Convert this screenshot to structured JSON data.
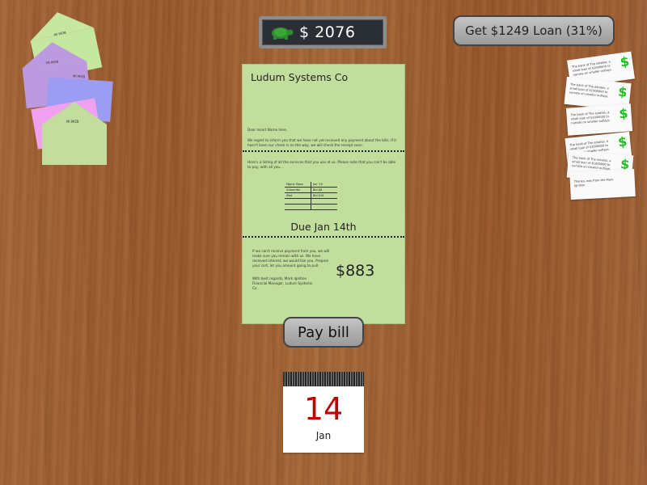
{
  "money": {
    "amount": "$ 2076",
    "icon": "turtle-icon"
  },
  "loan": {
    "label": "Get $1249 Loan (31%)"
  },
  "bill": {
    "company": "Ludum Systems Co",
    "greeting": "Dear Insert Name here,",
    "p1": "We regret to inform you that we have not yet received any payment about the bills. If it hasn't been our check is on the way, we will check the receipt soon.",
    "p2": "Here's a listing of all the services that you use at us. Please note that you can't be able to pay, with all you...",
    "table": [
      [
        "Mgmt. Base",
        "Jan '10"
      ],
      [
        "Subscribe",
        "Bid $8"
      ],
      [
        "iPad",
        "Bid $16"
      ],
      [
        "",
        ""
      ],
      [
        "",
        ""
      ]
    ],
    "due": "Due Jan 14th",
    "p3": "If we can't receive payment from you, we will make sure you remain with us. We have received interest, we would like you. Prepare your cart, let you amount going to pull.",
    "sign": "With best regards, Mark Ignition Financial Manager, Ludum Systems Co",
    "total": "$883"
  },
  "pay": {
    "label": "Pay bill"
  },
  "calendar": {
    "day": "14",
    "month": "Jan"
  },
  "envelopes": [
    {
      "color": "#c6e7a0",
      "label": "MI MOB"
    },
    {
      "color": "#bb9adf",
      "label": "MI MOB"
    },
    {
      "color": "#9c9cf2",
      "label": "MI MOB"
    },
    {
      "color": "#efa0ef",
      "label": ""
    },
    {
      "color": "#c2dd9e",
      "label": "MI MOB"
    }
  ],
  "checks": [
    {
      "text": "The bank of The estates, a small loan of $1000000 to narrate on smaller outlays.",
      "dollar": "$"
    },
    {
      "text": "The bank of The estates, a small loan of $1000000 to narrate on smaller outlays.",
      "dollar": "$"
    },
    {
      "text": "The bank of The estates, a small loan of $1000000 to narrate on smaller outlays.",
      "dollar": "$"
    },
    {
      "text": "The bank of The estates, a small loan of $1000000 to narrate on smaller outlays.",
      "dollar": "$"
    },
    {
      "text": "The bank of The estates, a small loan of $1000000 to narrate on smaller outlays.",
      "dollar": "$"
    },
    {
      "text": "Thanks, was from the Mark Ignition",
      "dollar": ""
    }
  ]
}
